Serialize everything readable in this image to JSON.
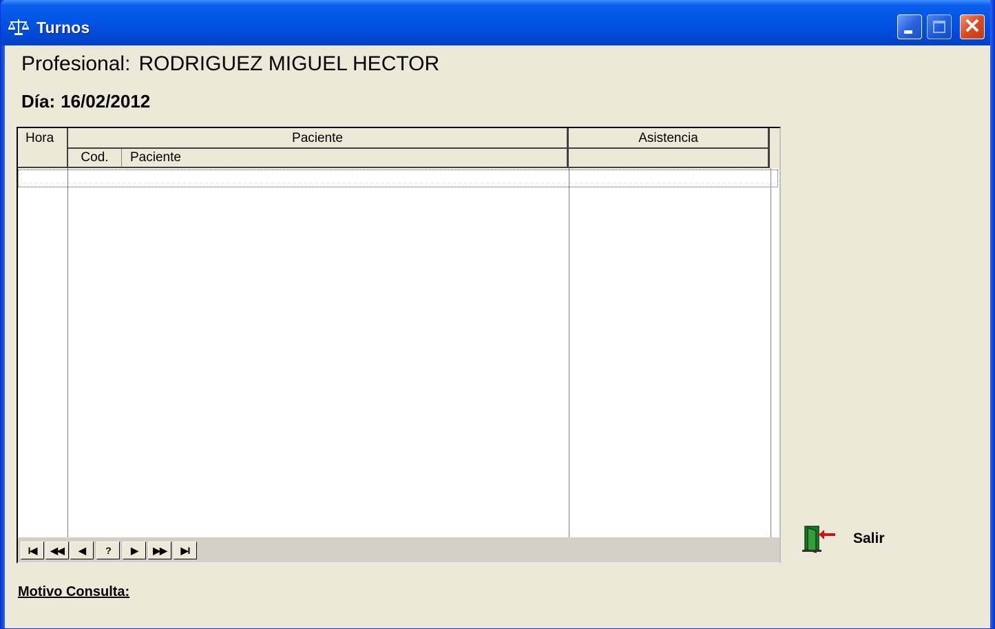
{
  "window": {
    "title": "Turnos",
    "buttons": {
      "minimize": "minimize",
      "maximize": "maximize",
      "close": "close"
    }
  },
  "header": {
    "profesional_label": "Profesional:",
    "profesional_value": "RODRIGUEZ MIGUEL HECTOR",
    "dia_label": "Día:",
    "dia_value": "16/02/2012"
  },
  "grid": {
    "columns": {
      "hora": "Hora",
      "paciente_group": "Paciente",
      "asistencia": "Asistencia",
      "cod": "Cod.",
      "paciente": "Paciente"
    },
    "rows": []
  },
  "navigator": {
    "buttons": [
      {
        "name": "first",
        "glyph": "I◀"
      },
      {
        "name": "prev-page",
        "glyph": "◀◀"
      },
      {
        "name": "prev",
        "glyph": "◀"
      },
      {
        "name": "query",
        "glyph": "?"
      },
      {
        "name": "next",
        "glyph": "▶"
      },
      {
        "name": "next-page",
        "glyph": "▶▶"
      },
      {
        "name": "last",
        "glyph": "▶I"
      }
    ]
  },
  "actions": {
    "salir_label": "Salir",
    "salir_icon": "exit-door-icon"
  },
  "footer": {
    "motivo_label": "Motivo Consulta:"
  },
  "colors": {
    "titlebar": "#0254e6",
    "window_bg": "#ece9d8",
    "grid_bg": "#ffffff",
    "close_button": "#dc4a22"
  }
}
